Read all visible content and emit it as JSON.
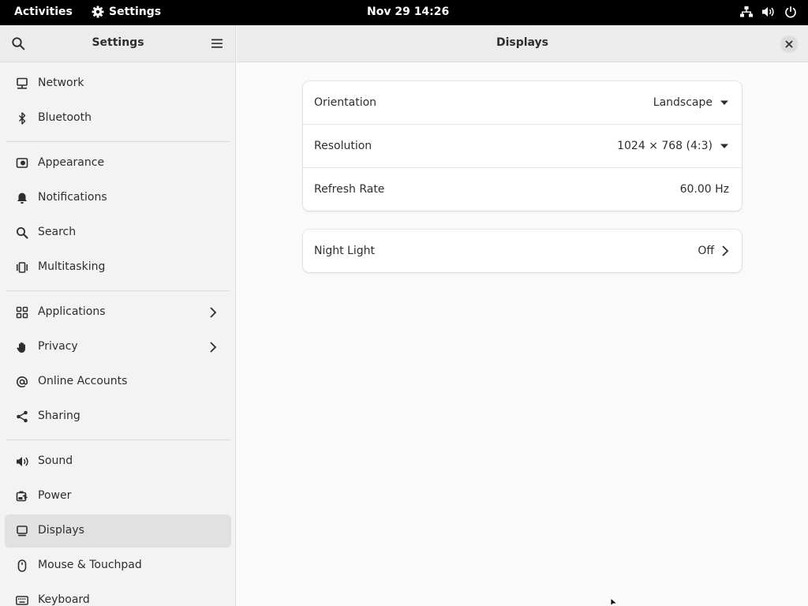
{
  "topbar": {
    "activities": "Activities",
    "app_name": "Settings",
    "clock": "Nov 29  14:26"
  },
  "sidebar": {
    "title": "Settings",
    "items": [
      {
        "label": "Network",
        "icon": "network-icon"
      },
      {
        "label": "Bluetooth",
        "icon": "bluetooth-icon"
      },
      {
        "label": "Appearance",
        "icon": "appearance-icon"
      },
      {
        "label": "Notifications",
        "icon": "bell-icon"
      },
      {
        "label": "Search",
        "icon": "search-icon"
      },
      {
        "label": "Multitasking",
        "icon": "multitasking-icon"
      },
      {
        "label": "Applications",
        "icon": "applications-icon",
        "has_submenu": true
      },
      {
        "label": "Privacy",
        "icon": "hand-icon",
        "has_submenu": true
      },
      {
        "label": "Online Accounts",
        "icon": "at-icon"
      },
      {
        "label": "Sharing",
        "icon": "share-icon"
      },
      {
        "label": "Sound",
        "icon": "speaker-icon"
      },
      {
        "label": "Power",
        "icon": "battery-icon"
      },
      {
        "label": "Displays",
        "icon": "display-icon",
        "active": true
      },
      {
        "label": "Mouse & Touchpad",
        "icon": "mouse-icon"
      },
      {
        "label": "Keyboard",
        "icon": "keyboard-icon"
      }
    ]
  },
  "main": {
    "title": "Displays",
    "display_settings": {
      "orientation": {
        "label": "Orientation",
        "value": "Landscape"
      },
      "resolution": {
        "label": "Resolution",
        "value": "1024 × 768 (4:3)"
      },
      "refresh_rate": {
        "label": "Refresh Rate",
        "value": "60.00 Hz"
      }
    },
    "night_light": {
      "label": "Night Light",
      "value": "Off"
    }
  },
  "colors": {
    "topbar_bg": "#000000",
    "sidebar_bg": "#f3f3f3",
    "active_item_bg": "#e1e1e1",
    "content_bg": "#fafafa",
    "card_bg": "#ffffff",
    "text": "#2e2e2e"
  }
}
